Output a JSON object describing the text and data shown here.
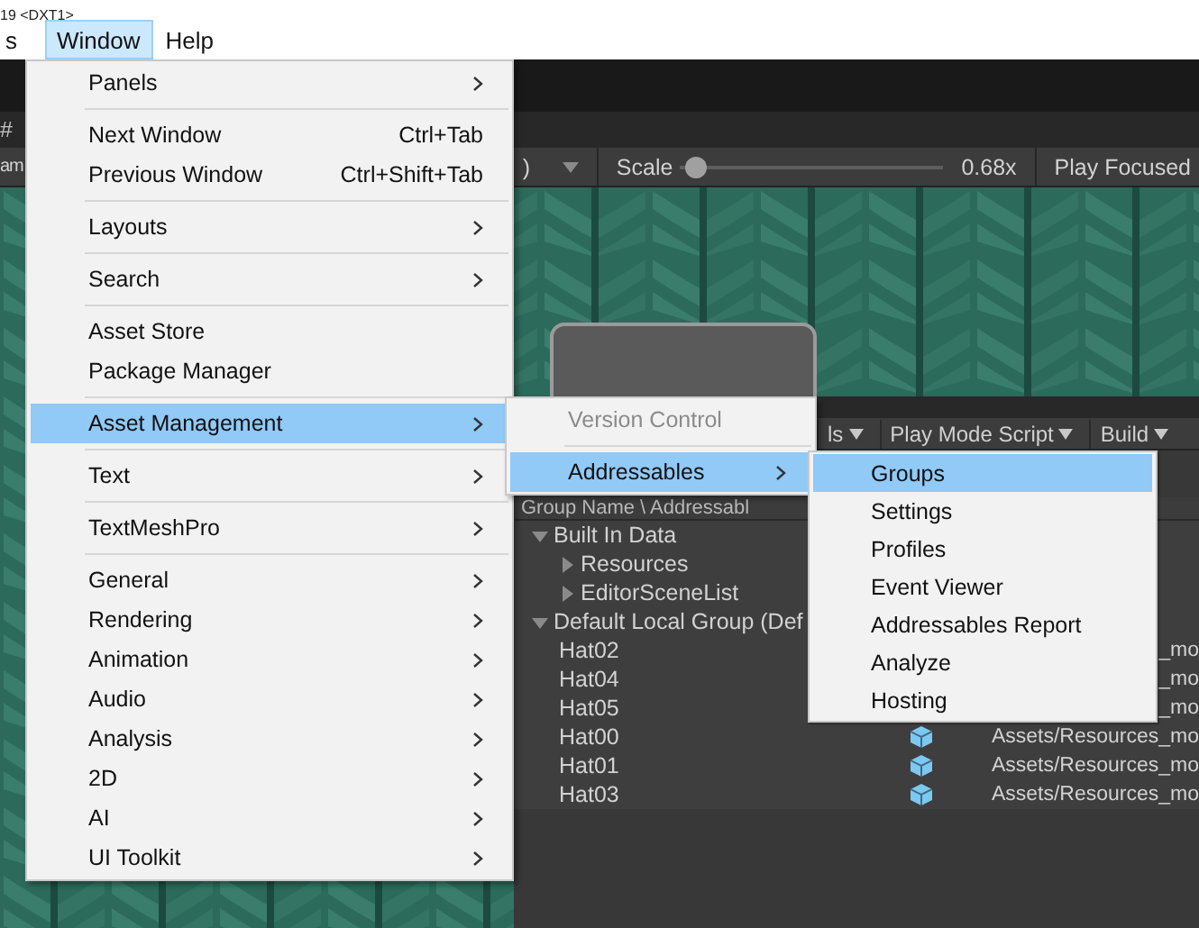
{
  "title": "19 <DXT1>",
  "menubar": [
    {
      "label": "s",
      "selected": false
    },
    {
      "label": "Window",
      "selected": true
    },
    {
      "label": "Help",
      "selected": false
    }
  ],
  "scene_tab": {
    "label": "#"
  },
  "toolbar": {
    "left_text": "am",
    "aspect_tail": ")",
    "scale_label": "Scale",
    "scale": {
      "level": 0.02
    },
    "scale_value": "0.68x",
    "play_mode": "Play Focused"
  },
  "addressables": {
    "toolbar": [
      "ls",
      "Play Mode Script",
      "Build"
    ],
    "header": "Group Name \\ Addressabl",
    "tree": [
      {
        "label": "Built In Data",
        "expanded": true,
        "children": [
          {
            "label": "Resources",
            "expanded": false
          },
          {
            "label": "EditorSceneList",
            "expanded": false
          }
        ]
      },
      {
        "label": "Default Local Group (Def",
        "expanded": true,
        "children": [
          {
            "label": "Hat02",
            "asset_icon": false,
            "path": "_mo"
          },
          {
            "label": "Hat04",
            "asset_icon": false,
            "path": "_mo"
          },
          {
            "label": "Hat05",
            "asset_icon": false,
            "path": "_mo"
          },
          {
            "label": "Hat00",
            "asset_icon": true,
            "path": "Assets/Resources_mo"
          },
          {
            "label": "Hat01",
            "asset_icon": true,
            "path": "Assets/Resources_mo"
          },
          {
            "label": "Hat03",
            "asset_icon": true,
            "path": "Assets/Resources_mo"
          }
        ]
      }
    ]
  },
  "menus": [
    {
      "groups": [
        [
          {
            "label": "Panels",
            "submenu": true,
            "selected": false
          }
        ],
        [
          {
            "label": "Next Window",
            "shortcut": "Ctrl+Tab",
            "selected": false
          },
          {
            "label": "Previous Window",
            "shortcut": "Ctrl+Shift+Tab",
            "selected": false
          }
        ],
        [
          {
            "label": "Layouts",
            "submenu": true,
            "selected": false
          }
        ],
        [
          {
            "label": "Search",
            "submenu": true,
            "selected": false
          }
        ],
        [
          {
            "label": "Asset Store",
            "selected": false
          },
          {
            "label": "Package Manager",
            "selected": false
          }
        ],
        [
          {
            "label": "Asset Management",
            "submenu": true,
            "selected": true
          }
        ],
        [
          {
            "label": "Text",
            "submenu": true,
            "selected": false
          }
        ],
        [
          {
            "label": "TextMeshPro",
            "submenu": true,
            "selected": false
          }
        ],
        [
          {
            "label": "General",
            "submenu": true,
            "selected": false
          },
          {
            "label": "Rendering",
            "submenu": true,
            "selected": false
          },
          {
            "label": "Animation",
            "submenu": true,
            "selected": false
          },
          {
            "label": "Audio",
            "submenu": true,
            "selected": false
          },
          {
            "label": "Analysis",
            "submenu": true,
            "selected": false
          },
          {
            "label": "2D",
            "submenu": true,
            "selected": false
          },
          {
            "label": "AI",
            "submenu": true,
            "selected": false
          },
          {
            "label": "UI Toolkit",
            "submenu": true,
            "selected": false
          }
        ]
      ]
    },
    {
      "groups": [
        [
          {
            "label": "Version Control",
            "disabled": true,
            "selected": false
          }
        ],
        [
          {
            "label": "Addressables",
            "submenu": true,
            "selected": true
          }
        ]
      ]
    },
    {
      "groups": [
        [
          {
            "label": "Groups",
            "selected": true
          },
          {
            "label": "Settings",
            "selected": false
          },
          {
            "label": "Profiles",
            "selected": false
          },
          {
            "label": "Event Viewer",
            "selected": false
          },
          {
            "label": "Addressables Report",
            "selected": false
          },
          {
            "label": "Analyze",
            "selected": false
          },
          {
            "label": "Hosting",
            "selected": false
          }
        ]
      ]
    }
  ]
}
